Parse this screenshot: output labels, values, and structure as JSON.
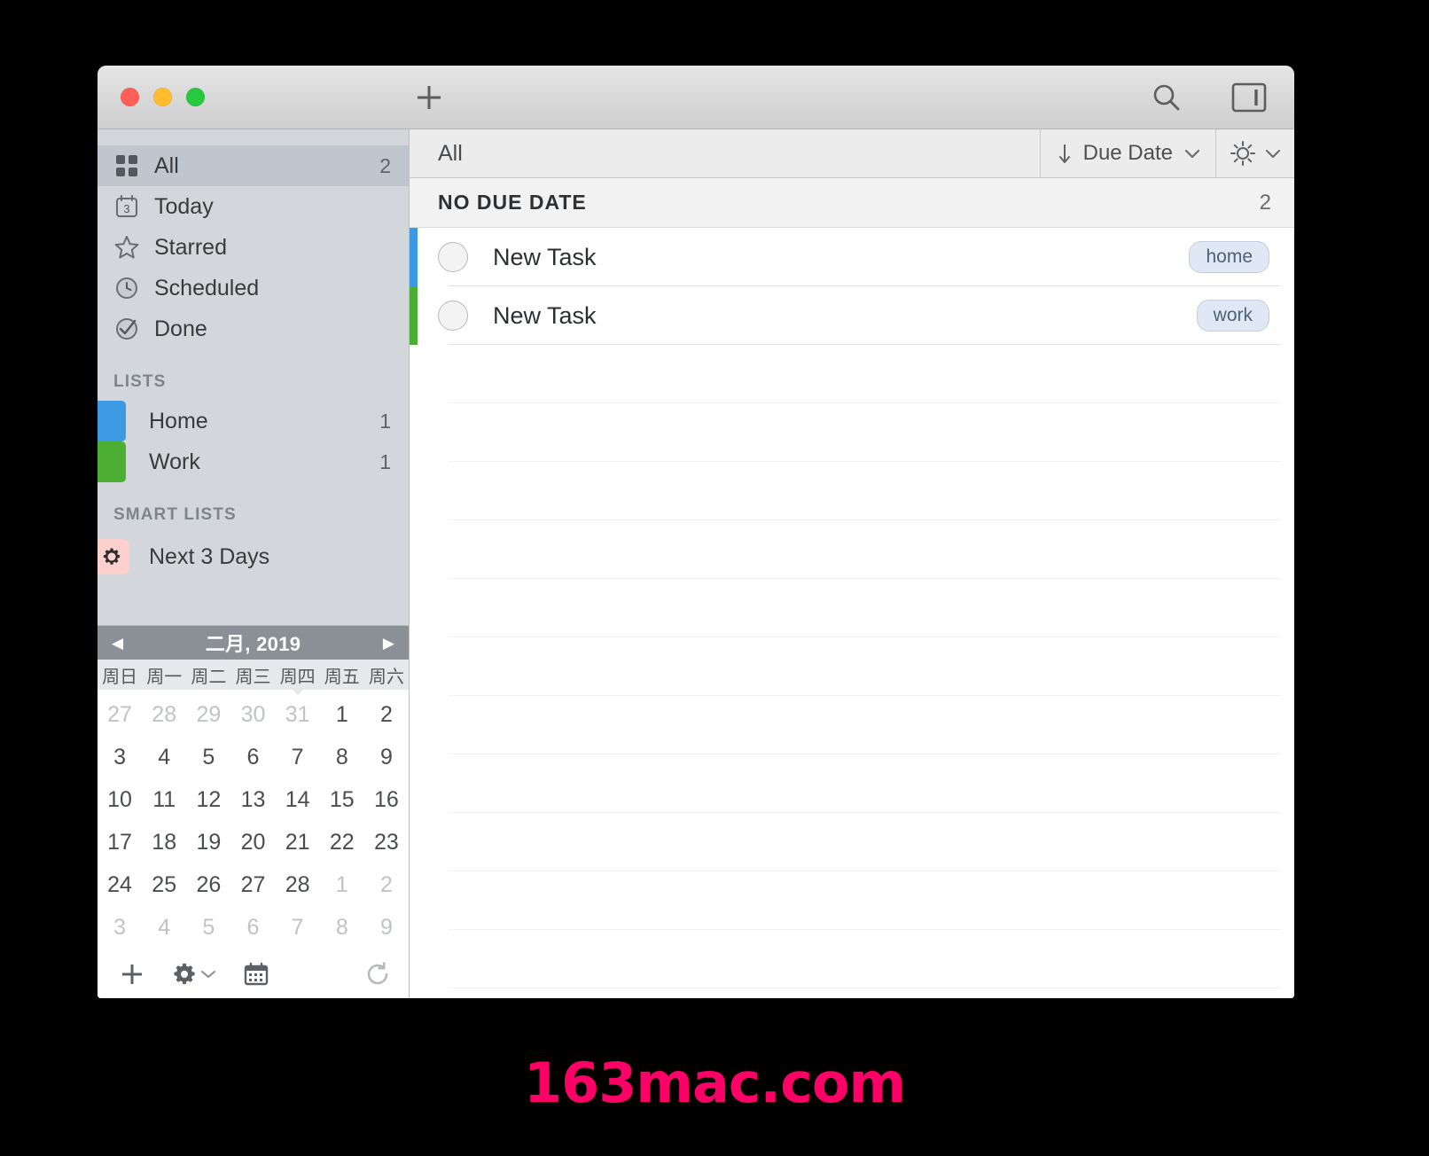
{
  "window": {
    "traffic_lights": [
      "close",
      "minimize",
      "maximize"
    ],
    "add_label": "+",
    "search_icon": "search-icon",
    "sidebar_toggle_icon": "sidebar-toggle-icon"
  },
  "sidebar": {
    "nav": [
      {
        "label": "All",
        "count": "2",
        "icon": "grid-icon",
        "selected": true
      },
      {
        "label": "Today",
        "count": "",
        "icon": "calendar-day-icon",
        "badge": "3",
        "selected": false
      },
      {
        "label": "Starred",
        "count": "",
        "icon": "star-icon",
        "selected": false
      },
      {
        "label": "Scheduled",
        "count": "",
        "icon": "clock-icon",
        "selected": false
      },
      {
        "label": "Done",
        "count": "",
        "icon": "check-circle-icon",
        "selected": false
      }
    ],
    "lists_header": "LISTS",
    "lists": [
      {
        "label": "Home",
        "count": "1",
        "color": "#3b9ae1"
      },
      {
        "label": "Work",
        "count": "1",
        "color": "#4caf34"
      }
    ],
    "smart_lists_header": "SMART LISTS",
    "smart_lists": [
      {
        "label": "Next 3 Days",
        "icon": "gear-icon",
        "badge_color": "#fbd0cd"
      }
    ]
  },
  "calendar": {
    "title": "二月, 2019",
    "prev_label": "◀",
    "next_label": "▶",
    "weekdays": [
      "周日",
      "周一",
      "周二",
      "周三",
      "周四",
      "周五",
      "周六"
    ],
    "marker_weekday_index": 4,
    "weeks": [
      [
        {
          "d": "27",
          "o": true
        },
        {
          "d": "28",
          "o": true
        },
        {
          "d": "29",
          "o": true
        },
        {
          "d": "30",
          "o": true
        },
        {
          "d": "31",
          "o": true
        },
        {
          "d": "1",
          "o": false
        },
        {
          "d": "2",
          "o": false
        }
      ],
      [
        {
          "d": "3",
          "o": false
        },
        {
          "d": "4",
          "o": false
        },
        {
          "d": "5",
          "o": false
        },
        {
          "d": "6",
          "o": false
        },
        {
          "d": "7",
          "o": false
        },
        {
          "d": "8",
          "o": false
        },
        {
          "d": "9",
          "o": false
        }
      ],
      [
        {
          "d": "10",
          "o": false
        },
        {
          "d": "11",
          "o": false
        },
        {
          "d": "12",
          "o": false
        },
        {
          "d": "13",
          "o": false
        },
        {
          "d": "14",
          "o": false
        },
        {
          "d": "15",
          "o": false
        },
        {
          "d": "16",
          "o": false
        }
      ],
      [
        {
          "d": "17",
          "o": false
        },
        {
          "d": "18",
          "o": false
        },
        {
          "d": "19",
          "o": false
        },
        {
          "d": "20",
          "o": false
        },
        {
          "d": "21",
          "o": false
        },
        {
          "d": "22",
          "o": false
        },
        {
          "d": "23",
          "o": false
        }
      ],
      [
        {
          "d": "24",
          "o": false
        },
        {
          "d": "25",
          "o": false
        },
        {
          "d": "26",
          "o": false
        },
        {
          "d": "27",
          "o": false
        },
        {
          "d": "28",
          "o": false
        },
        {
          "d": "1",
          "o": true
        },
        {
          "d": "2",
          "o": true
        }
      ],
      [
        {
          "d": "3",
          "o": true
        },
        {
          "d": "4",
          "o": true
        },
        {
          "d": "5",
          "o": true
        },
        {
          "d": "6",
          "o": true
        },
        {
          "d": "7",
          "o": true
        },
        {
          "d": "8",
          "o": true
        },
        {
          "d": "9",
          "o": true
        }
      ]
    ],
    "toolbar": {
      "add_icon": "plus-icon",
      "settings_icon": "gear-icon",
      "settings_chevron": "chevron-down-icon",
      "calendar_icon": "calendar-icon",
      "refresh_icon": "refresh-icon"
    }
  },
  "main": {
    "title": "All",
    "sort": {
      "icon": "sort-descending-icon",
      "label": "Due Date",
      "chevron": "chevron-down-icon"
    },
    "view": {
      "icon": "brightness-icon",
      "chevron": "chevron-down-icon"
    },
    "group": {
      "title": "NO DUE DATE",
      "count": "2"
    },
    "tasks": [
      {
        "title": "New Task",
        "tag": "home",
        "stripe": "#3b9ae1",
        "checked": false
      },
      {
        "title": "New Task",
        "tag": "work",
        "stripe": "#4caf34",
        "checked": false
      }
    ]
  },
  "watermark": {
    "text": "163mac.com",
    "color": "#ff0066"
  }
}
